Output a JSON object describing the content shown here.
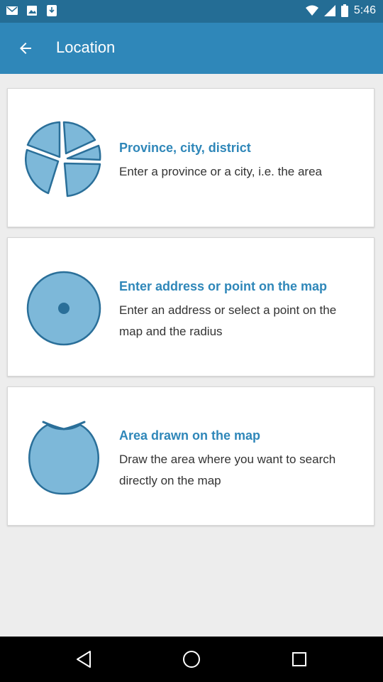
{
  "status_bar": {
    "time": "5:46"
  },
  "app_bar": {
    "title": "Location",
    "back_icon": "arrow-left-icon"
  },
  "options": [
    {
      "title": "Province, city, district",
      "description": "Enter a province or a city, i.e. the area",
      "icon": "pie-area-icon"
    },
    {
      "title": "Enter address or point on the map",
      "description": "Enter an address or select a point on the map and the radius",
      "icon": "circle-point-icon"
    },
    {
      "title": "Area drawn on the map",
      "description": "Draw the area where you want to search directly on the map",
      "icon": "drawn-area-icon"
    }
  ],
  "colors": {
    "status_bar": "#246d95",
    "app_bar": "#2f87b9",
    "accent": "#2f87b9",
    "icon_fill": "#7db8d9",
    "icon_stroke": "#2a6f99",
    "background": "#ededed"
  }
}
